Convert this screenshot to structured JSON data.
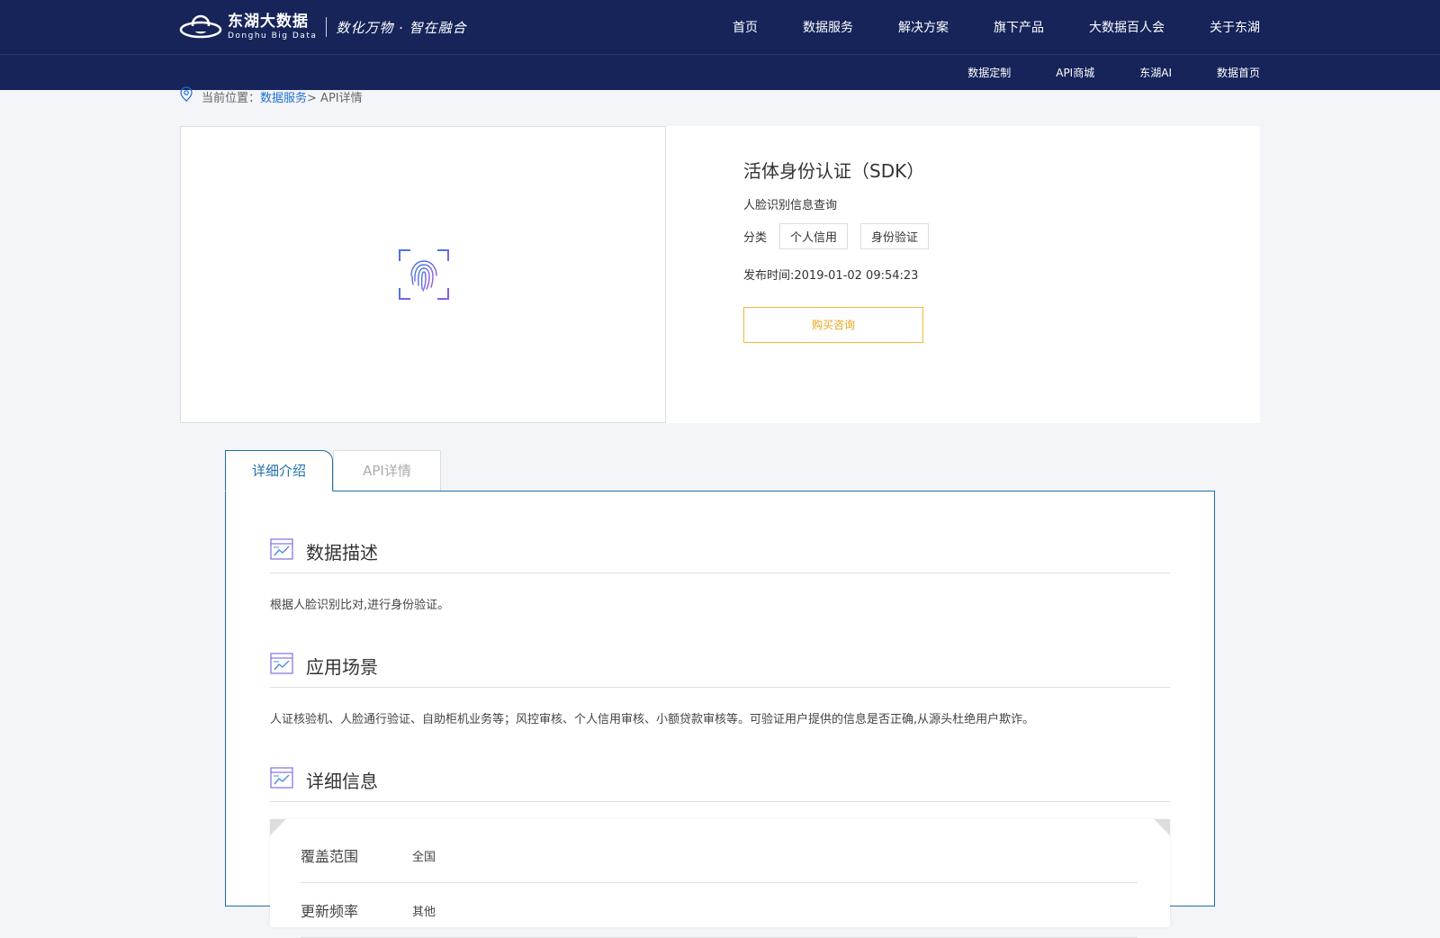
{
  "header": {
    "brand_cn": "东湖大数据",
    "brand_en": "Donghu Big Data",
    "slogan": "数化万物 · 智在融合",
    "nav": [
      "首页",
      "数据服务",
      "解决方案",
      "旗下产品",
      "大数据百人会",
      "关于东湖"
    ],
    "subnav": [
      "数据定制",
      "API商城",
      "东湖AI",
      "数据首页"
    ]
  },
  "breadcrumb": {
    "prefix": "当前位置：",
    "link": "数据服务",
    "current": " > API详情"
  },
  "product": {
    "title": "活体身份认证（SDK）",
    "subtitle": "人脸识别信息查询",
    "category_label": "分类",
    "tags": [
      "个人信用",
      "身份验证"
    ],
    "publish_time": "发布时间:2019-01-02 09:54:23",
    "buy_label": "购买咨询",
    "icon": "fingerprint-icon"
  },
  "tabs": [
    "详细介绍",
    "API详情"
  ],
  "sections": {
    "desc": {
      "title": "数据描述",
      "body": "根据人脸识别比对,进行身份验证。"
    },
    "scene": {
      "title": "应用场景",
      "body": "人证核验机、人脸通行验证、自助柜机业务等；风控审核、个人信用审核、小额贷款审核等。可验证用户提供的信息是否正确,从源头杜绝用户欺诈。"
    },
    "detail": {
      "title": "详细信息"
    }
  },
  "detail_rows": [
    {
      "key": "覆盖范围",
      "value": "全国"
    },
    {
      "key": "更新频率",
      "value": "其他"
    }
  ],
  "colors": {
    "header_bg": "#16245a",
    "accent": "#1e6fa8",
    "buy": "#f2b63a"
  }
}
